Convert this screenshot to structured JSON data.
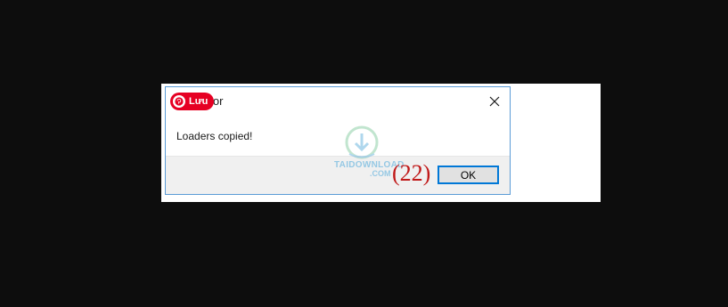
{
  "dialog": {
    "title": "ator",
    "message": "Loaders copied!",
    "ok_label": "OK",
    "close_icon": "close-icon"
  },
  "pin_badge": {
    "label": "Lưu",
    "icon": "pinterest-icon",
    "color": "#e60023"
  },
  "watermark": {
    "line1": "TAIDOWNLOAD",
    "line2": ".COM",
    "icon": "download-arrow-icon",
    "color": "#6fb8e0"
  },
  "annotation": {
    "text": "(22)",
    "color": "#c01818"
  },
  "colors": {
    "background": "#0d0d0d",
    "dialog_border": "#5a9bd6",
    "button_focus": "#0078d7",
    "footer": "#f0f0f0"
  }
}
